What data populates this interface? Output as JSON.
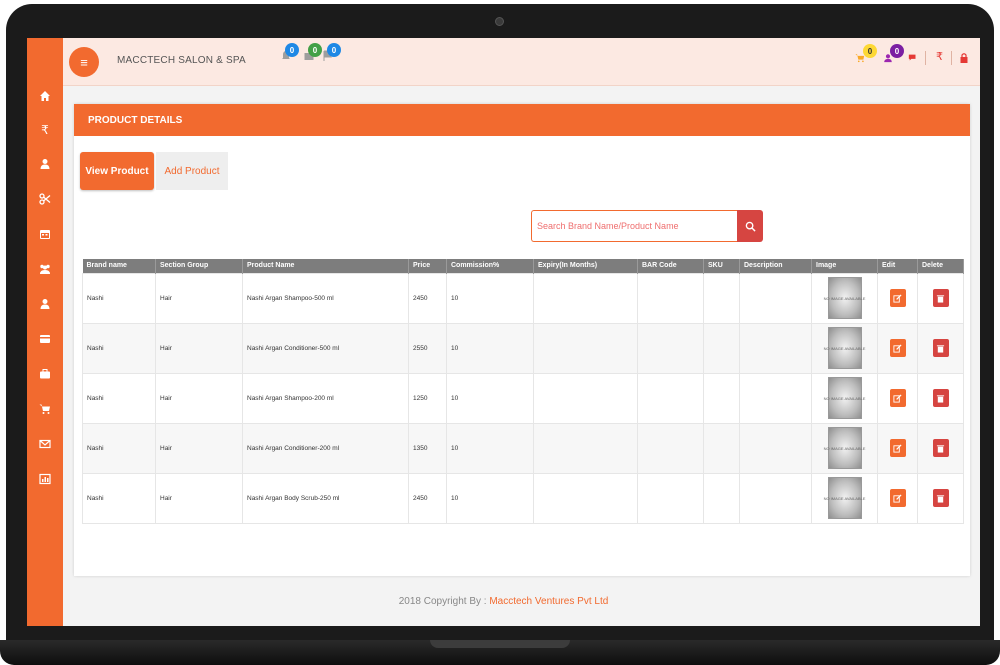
{
  "app": {
    "title": "MACCTECH SALON & SPA"
  },
  "topbar": {
    "badges": [
      "0",
      "0",
      "0"
    ],
    "badge_colors": [
      "#1e88e5",
      "#43a047",
      "#1e88e5"
    ],
    "right_badges": [
      "0",
      "0"
    ],
    "right_icons": [
      "cart-icon",
      "user-icon",
      "chat-icon",
      "rupee-icon",
      "lock-icon",
      "power-icon"
    ],
    "rupee": "₹"
  },
  "sidebar": {
    "items": [
      "home-icon",
      "rupee-icon",
      "user-icon",
      "scissors-icon",
      "calendar-icon",
      "group-icon",
      "user-icon",
      "card-icon",
      "briefcase-icon",
      "cart-icon",
      "mail-icon",
      "report-icon"
    ]
  },
  "section": {
    "title": "PRODUCT DETAILS"
  },
  "tabs": {
    "view": "View Product",
    "add": "Add Product"
  },
  "search": {
    "placeholder": "Search Brand Name/Product Name"
  },
  "table": {
    "headers": [
      "Brand name",
      "Section Group",
      "Product Name",
      "Price",
      "Commission%",
      "Expiry(In Months)",
      "BAR Code",
      "SKU",
      "Description",
      "Image",
      "Edit",
      "Delete"
    ],
    "image_placeholder": "NO IMAGE AVAILABLE",
    "rows": [
      {
        "brand": "Nashi",
        "section": "Hair",
        "product": "Nashi Argan Shampoo-500 ml",
        "price": "2450",
        "commission": "10",
        "expiry": "",
        "barcode": "",
        "sku": "",
        "description": ""
      },
      {
        "brand": "Nashi",
        "section": "Hair",
        "product": "Nashi Argan Conditioner-500 ml",
        "price": "2550",
        "commission": "10",
        "expiry": "",
        "barcode": "",
        "sku": "",
        "description": ""
      },
      {
        "brand": "Nashi",
        "section": "Hair",
        "product": "Nashi Argan Shampoo-200 ml",
        "price": "1250",
        "commission": "10",
        "expiry": "",
        "barcode": "",
        "sku": "",
        "description": ""
      },
      {
        "brand": "Nashi",
        "section": "Hair",
        "product": "Nashi Argan Conditioner-200 ml",
        "price": "1350",
        "commission": "10",
        "expiry": "",
        "barcode": "",
        "sku": "",
        "description": ""
      },
      {
        "brand": "Nashi",
        "section": "Hair",
        "product": "Nashi Argan Body Scrub-250 ml",
        "price": "2450",
        "commission": "10",
        "expiry": "",
        "barcode": "",
        "sku": "",
        "description": ""
      }
    ]
  },
  "footer": {
    "prefix": "2018 Copyright By : ",
    "link": "Macctech Ventures Pvt Ltd"
  },
  "colors": {
    "accent": "#f26a2f",
    "danger": "#d64541",
    "header_gray": "#7d7d7d"
  }
}
